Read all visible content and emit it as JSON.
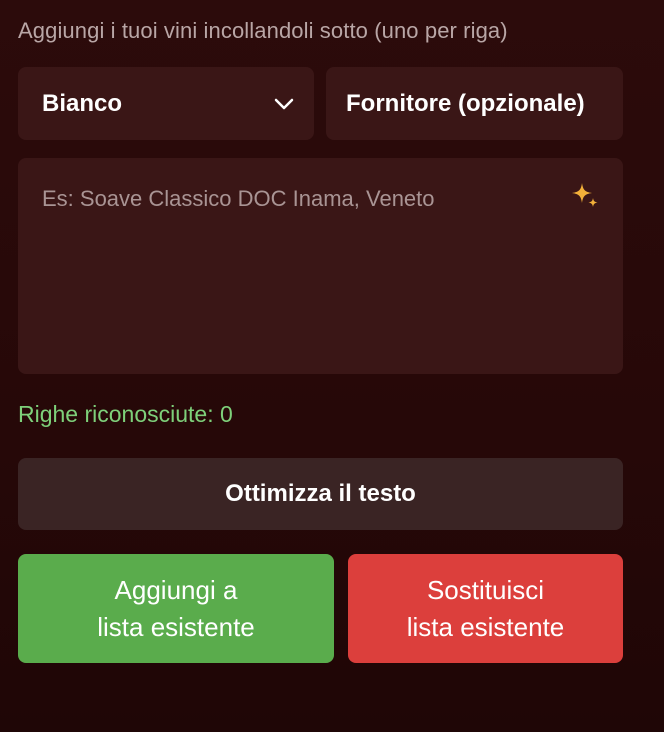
{
  "instruction": "Aggiungi i tuoi vini incollandoli sotto (uno per riga)",
  "wine_type_select": {
    "value": "Bianco"
  },
  "supplier_field": {
    "placeholder": "Fornitore (opzionale)"
  },
  "wines_textarea": {
    "placeholder": "Es: Soave Classico DOC Inama, Veneto",
    "icon": "sparkles-icon"
  },
  "recognized_lines": "Righe riconosciute: 0",
  "optimize_button": "Ottimizza il testo",
  "add_button": {
    "line1": "Aggiungi a",
    "line2": "lista esistente"
  },
  "replace_button": {
    "line1": "Sostituisci",
    "line2": "lista esistente"
  },
  "colors": {
    "background": "#2a0a0a",
    "field": "#3a1616",
    "add": "#5aac4c",
    "replace": "#dc3f3c",
    "success_text": "#7ed07a",
    "sparkle": "#f2b03a"
  }
}
